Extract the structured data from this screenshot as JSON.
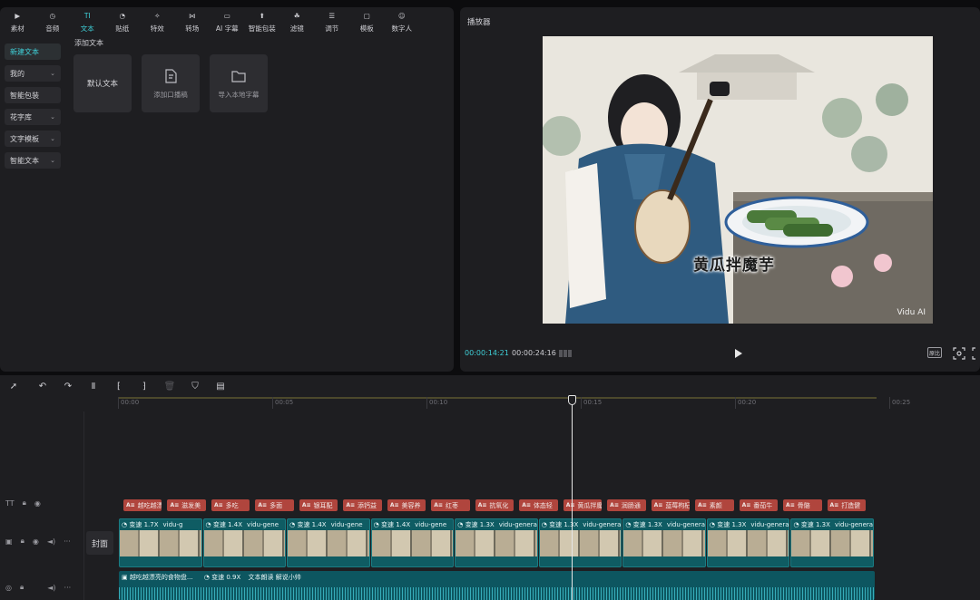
{
  "left_panel": {
    "tabs": [
      {
        "label": "素材",
        "icon": "media-icon"
      },
      {
        "label": "音频",
        "icon": "audio-icon"
      },
      {
        "label": "文本",
        "icon": "text-icon"
      },
      {
        "label": "贴纸",
        "icon": "sticker-icon"
      },
      {
        "label": "特效",
        "icon": "effects-icon"
      },
      {
        "label": "转场",
        "icon": "transition-icon"
      },
      {
        "label": "AI 字幕",
        "icon": "ai-subtitle-icon"
      },
      {
        "label": "智能包装",
        "icon": "smart-pack-icon"
      },
      {
        "label": "滤镜",
        "icon": "filter-icon"
      },
      {
        "label": "调节",
        "icon": "adjust-icon"
      },
      {
        "label": "模板",
        "icon": "template-icon"
      },
      {
        "label": "数字人",
        "icon": "avatar-icon"
      }
    ],
    "active_tab": "文本",
    "side_menu": [
      {
        "label": "新建文本",
        "active": true,
        "has_chevron": false
      },
      {
        "label": "我的",
        "active": false,
        "has_chevron": true
      },
      {
        "label": "智能包装",
        "active": false,
        "has_chevron": false
      },
      {
        "label": "花字库",
        "active": false,
        "has_chevron": true
      },
      {
        "label": "文字模板",
        "active": false,
        "has_chevron": true
      },
      {
        "label": "智能文本",
        "active": false,
        "has_chevron": true
      }
    ],
    "section_title": "添加文本",
    "cards": {
      "default_text": "默认文本",
      "add_voiceover": "添加口播稿",
      "import_subtitle": "导入本地字幕"
    }
  },
  "player": {
    "title": "播放器",
    "caption": "黄瓜拌魔芋",
    "watermark": "Vidu AI",
    "time_current": "00:00:14:21",
    "time_total": "00:00:24:16",
    "ratio_label": "原比"
  },
  "timeline": {
    "ruler_labels": [
      "00:00",
      "00:05",
      "00:10",
      "00:15",
      "00:20",
      "00:25"
    ],
    "cover_label": "封面",
    "text_clips": [
      "越吃越漂亮的",
      "滋发美",
      "多吃",
      "多面",
      "银耳配",
      "添钙益",
      "美容养",
      "红枣",
      "抗氧化",
      "体态轻",
      "黄瓜拌魔",
      "润肠通",
      "蓝莓枸杞",
      "素颜",
      "番茄牛",
      "骨骼",
      "打造健"
    ],
    "video_clips": [
      {
        "speed": "变速 1.7X",
        "name": "vidu-g"
      },
      {
        "speed": "变速 1.4X",
        "name": "vidu-gene"
      },
      {
        "speed": "变速 1.4X",
        "name": "vidu-gene"
      },
      {
        "speed": "变速 1.4X",
        "name": "vidu-gene"
      },
      {
        "speed": "变速 1.3X",
        "name": "vidu-genera"
      },
      {
        "speed": "变速 1.3X",
        "name": "vidu-genera"
      },
      {
        "speed": "变速 1.3X",
        "name": "vidu-genera"
      },
      {
        "speed": "变速 1.3X",
        "name": "vidu-genera"
      },
      {
        "speed": "变速 1.3X",
        "name": "vidu-genera"
      }
    ],
    "audio": {
      "name": "越吃越漂亮的食物盘...",
      "speed": "变速 0.9X",
      "voice": "文本朗读 解说小帅"
    }
  }
}
